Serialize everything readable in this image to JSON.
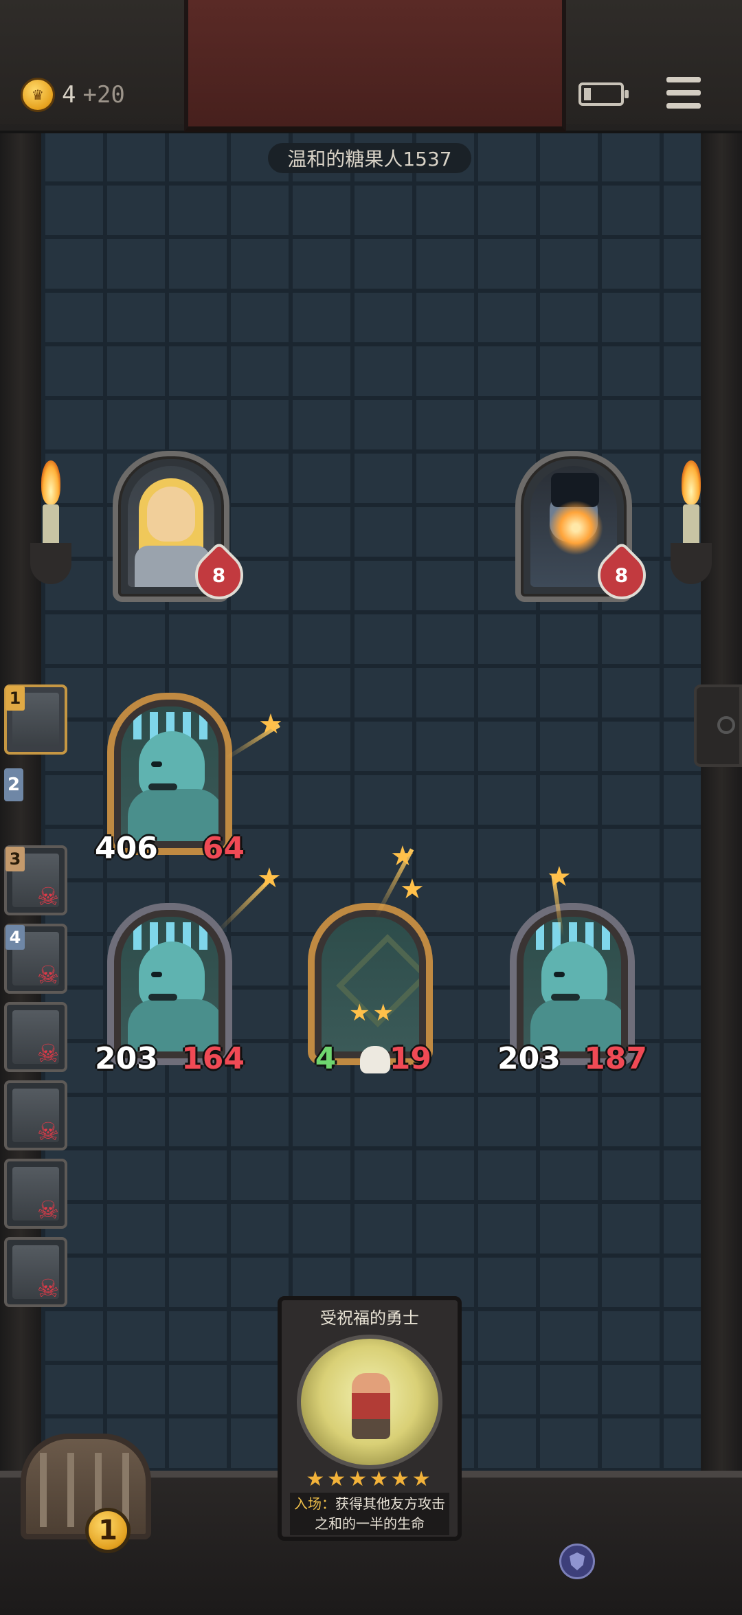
{
  "header": {
    "gold": "4",
    "gold_income": "+20",
    "opponent_name": "温和的糖果人1537"
  },
  "heroes": {
    "player_health": "8",
    "opponent_health": "8"
  },
  "shop_tiers": {
    "tier1_label": "1",
    "tier2_label": "2",
    "tier3_label": "3",
    "tier4_label": "4",
    "eliminated_icon": "skull-icon"
  },
  "board": {
    "front_minion": {
      "attack": "406",
      "health": "64"
    },
    "minion_left": {
      "attack": "203",
      "health": "164"
    },
    "minion_center": {
      "attack": "4",
      "health": "19"
    },
    "minion_right": {
      "attack": "203",
      "health": "187"
    }
  },
  "hand_card": {
    "name": "受祝福的勇士",
    "stars": "★★★★★★",
    "keyword": "入场：",
    "description": "获得其他友方攻击之和的一半的生命"
  },
  "chest": {
    "count": "1"
  },
  "colors": {
    "gold_frame": "#c08a42",
    "silver_frame": "#6f6e7a",
    "health_red": "#f04a55",
    "wall": "#263440"
  }
}
